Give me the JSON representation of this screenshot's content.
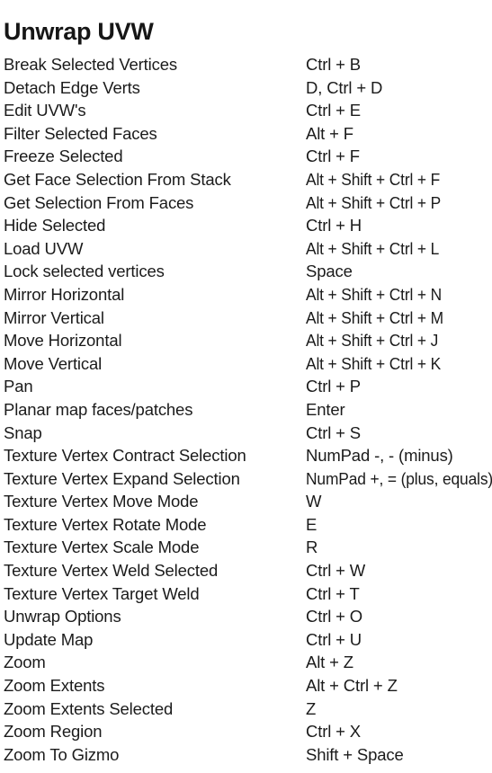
{
  "document": {
    "title": "Unwrap UVW",
    "accent_color": "#1b1b1b",
    "background_color": "#ffffff"
  },
  "columns": {
    "command_header": "",
    "shortcut_header": ""
  },
  "shortcuts": [
    {
      "command": "Break Selected Vertices",
      "keys": "Ctrl + B"
    },
    {
      "command": "Detach Edge Verts",
      "keys": "D, Ctrl + D"
    },
    {
      "command": "Edit UVW's",
      "keys": "Ctrl + E"
    },
    {
      "command": "Filter Selected Faces",
      "keys": "Alt + F"
    },
    {
      "command": "Freeze Selected",
      "keys": "Ctrl + F"
    },
    {
      "command": "Get Face Selection From Stack",
      "keys": "Alt + Shift + Ctrl + F"
    },
    {
      "command": "Get Selection From Faces",
      "keys": "Alt + Shift + Ctrl + P"
    },
    {
      "command": "Hide Selected",
      "keys": "Ctrl + H"
    },
    {
      "command": "Load UVW",
      "keys": "Alt + Shift + Ctrl + L"
    },
    {
      "command": "Lock selected vertices",
      "keys": "Space"
    },
    {
      "command": "Mirror Horizontal",
      "keys": "Alt + Shift + Ctrl + N"
    },
    {
      "command": "Mirror Vertical",
      "keys": "Alt + Shift + Ctrl + M"
    },
    {
      "command": "Move Horizontal",
      "keys": "Alt + Shift + Ctrl + J"
    },
    {
      "command": "Move Vertical",
      "keys": "Alt + Shift + Ctrl + K"
    },
    {
      "command": "Pan",
      "keys": "Ctrl + P"
    },
    {
      "command": "Planar map faces/patches",
      "keys": "Enter"
    },
    {
      "command": "Snap",
      "keys": "Ctrl + S"
    },
    {
      "command": "Texture Vertex Contract Selection",
      "keys": "NumPad -,  - (minus)"
    },
    {
      "command": "Texture Vertex Expand Selection",
      "keys": "NumPad +, = (plus, equals)"
    },
    {
      "command": "Texture Vertex Move Mode",
      "keys": "W"
    },
    {
      "command": "Texture Vertex Rotate Mode",
      "keys": "E"
    },
    {
      "command": "Texture Vertex Scale Mode",
      "keys": "R"
    },
    {
      "command": "Texture Vertex Weld Selected",
      "keys": "Ctrl + W"
    },
    {
      "command": "Texture Vertex Target Weld",
      "keys": "Ctrl + T"
    },
    {
      "command": "Unwrap Options",
      "keys": "Ctrl + O"
    },
    {
      "command": "Update Map",
      "keys": "Ctrl + U"
    },
    {
      "command": "Zoom",
      "keys": "Alt + Z"
    },
    {
      "command": "Zoom Extents",
      "keys": "Alt + Ctrl + Z"
    },
    {
      "command": "Zoom Extents Selected",
      "keys": "Z"
    },
    {
      "command": "Zoom Region",
      "keys": "Ctrl + X"
    },
    {
      "command": "Zoom To Gizmo",
      "keys": "Shift + Space"
    }
  ]
}
